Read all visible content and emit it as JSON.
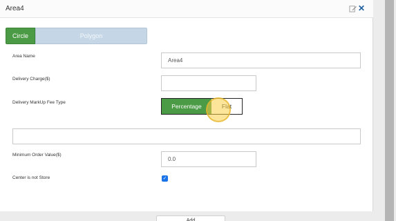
{
  "panel": {
    "title": "Area4",
    "edit_icon": "edit-icon",
    "close_icon": "close-icon"
  },
  "tabs": [
    {
      "label": "Circle",
      "active": true
    },
    {
      "label": "Polygon",
      "active": false
    }
  ],
  "form": {
    "area_name": {
      "label": "Area Name",
      "value": "Area4"
    },
    "delivery_charge": {
      "label": "Delivery Charge($)",
      "value": ""
    },
    "markup_fee_type": {
      "label": "Delivery MarkUp Fee Type",
      "options": [
        "Percentage",
        "Flat"
      ],
      "selected": "Percentage"
    },
    "markup_value": {
      "value": ""
    },
    "min_order": {
      "label": "Minimum Order Value($)",
      "value": "0.0"
    },
    "center_not_store": {
      "label": "Center is not Store",
      "checked": true
    }
  },
  "footer": {
    "button_label": "Add"
  },
  "colors": {
    "active": "#4b9a45",
    "inactive_tab": "#c5d6e6",
    "accent": "#1a73e8",
    "close": "#1d5c9e"
  }
}
